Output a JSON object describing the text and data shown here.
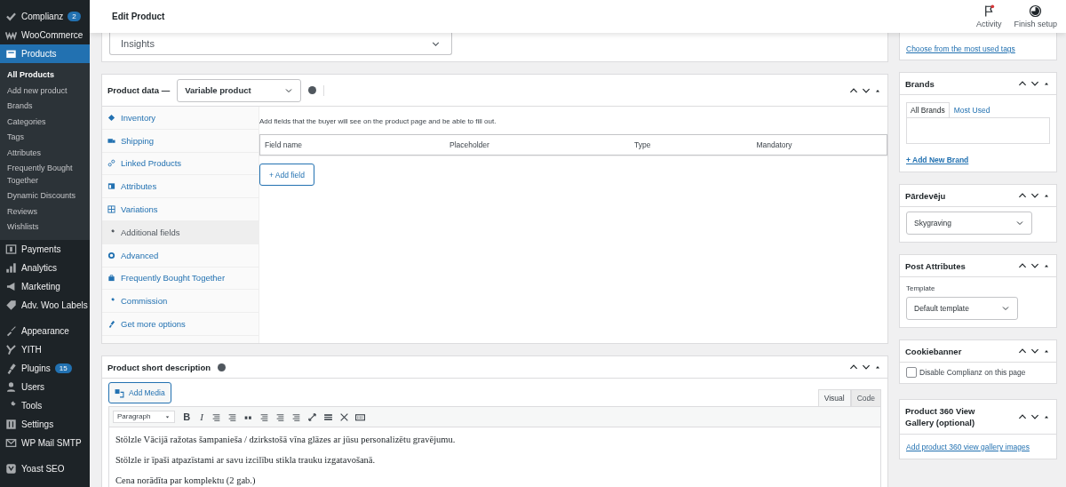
{
  "sidebar": {
    "groups": [
      {
        "items": [
          {
            "label": "Complianz",
            "badge": "2",
            "selected": false
          },
          {
            "label": "WooCommerce",
            "selected": false
          },
          {
            "label": "Products",
            "selected": true,
            "children": [
              {
                "label": "All Products",
                "selected": true
              },
              {
                "label": "Add new product",
                "selected": false
              },
              {
                "label": "Brands",
                "selected": false
              },
              {
                "label": "Categories",
                "selected": false
              },
              {
                "label": "Tags",
                "selected": false
              },
              {
                "label": "Attributes",
                "selected": false
              },
              {
                "label": "Frequently Bought Together",
                "selected": false
              },
              {
                "label": "Dynamic Discounts",
                "selected": false
              },
              {
                "label": "Reviews",
                "selected": false
              },
              {
                "label": "Wishlists",
                "selected": false
              }
            ]
          },
          {
            "label": "Payments",
            "selected": false
          },
          {
            "label": "Analytics",
            "selected": false
          },
          {
            "label": "Marketing",
            "selected": false
          },
          {
            "label": "Adv. Woo Labels",
            "selected": false
          }
        ]
      },
      {
        "items": [
          {
            "label": "Appearance",
            "selected": false
          },
          {
            "label": "YITH",
            "selected": false
          },
          {
            "label": "Plugins",
            "badge": "15",
            "selected": false
          },
          {
            "label": "Users",
            "selected": false
          },
          {
            "label": "Tools",
            "selected": false
          },
          {
            "label": "Settings",
            "selected": false
          },
          {
            "label": "WP Mail SMTP",
            "selected": false
          }
        ]
      },
      {
        "items": [
          {
            "label": "Yoast SEO",
            "selected": false
          }
        ]
      }
    ]
  },
  "header": {
    "title": "Edit Product",
    "actions": [
      {
        "label": "Activity"
      },
      {
        "label": "Finish setup"
      }
    ]
  },
  "insights": {
    "value": "Insights"
  },
  "product_data": {
    "title": "Product data —",
    "type_select": "Variable product",
    "tabs": [
      {
        "label": "Inventory",
        "selected": false
      },
      {
        "label": "Shipping",
        "selected": false
      },
      {
        "label": "Linked Products",
        "selected": false
      },
      {
        "label": "Attributes",
        "selected": false
      },
      {
        "label": "Variations",
        "selected": false
      },
      {
        "label": "Additional fields",
        "selected": true
      },
      {
        "label": "Advanced",
        "selected": false
      },
      {
        "label": "Frequently Bought Together",
        "selected": false
      },
      {
        "label": "Commission",
        "selected": false
      },
      {
        "label": "Get more options",
        "selected": false
      }
    ],
    "panel": {
      "description": "Add fields that the buyer will see on the product page and be able to fill out.",
      "columns": [
        "Field name",
        "Placeholder",
        "Type",
        "Mandatory"
      ],
      "add_button": "+ Add field"
    }
  },
  "short_description": {
    "title": "Product short description",
    "add_media": "Add Media",
    "editor_tabs": [
      {
        "label": "Visual",
        "selected": true
      },
      {
        "label": "Code",
        "selected": false
      }
    ],
    "format_select": "Paragraph",
    "toolbar": [
      "B",
      "I"
    ],
    "paragraphs": [
      "Stölzle Vācijā ražotas šampanieša / dzirkstošā vīna glāzes ar jūsu personalizētu gravējumu.",
      "Stölzle ir īpaši atpazīstami ar savu izcilību stikla trauku izgatavošanā.",
      "Cena norādīta par komplektu (2 gab.)"
    ]
  },
  "tags": {
    "link": "Choose from the most used tags"
  },
  "brands": {
    "title": "Brands",
    "tabs": [
      {
        "label": "All Brands",
        "selected": true
      },
      {
        "label": "Most Used",
        "selected": false
      }
    ],
    "add_link": "+ Add New Brand"
  },
  "vendor": {
    "title": "Pārdevēju",
    "value": "Skygraving"
  },
  "post_attributes": {
    "title": "Post Attributes",
    "template_label": "Template",
    "template_value": "Default template"
  },
  "cookiebanner": {
    "title": "Cookiebanner",
    "checkbox": {
      "label": "Disable Complianz on this page",
      "checked": false
    }
  },
  "gallery": {
    "title": "Product 360 View Gallery (optional)",
    "link": "Add product 360 view gallery images"
  }
}
